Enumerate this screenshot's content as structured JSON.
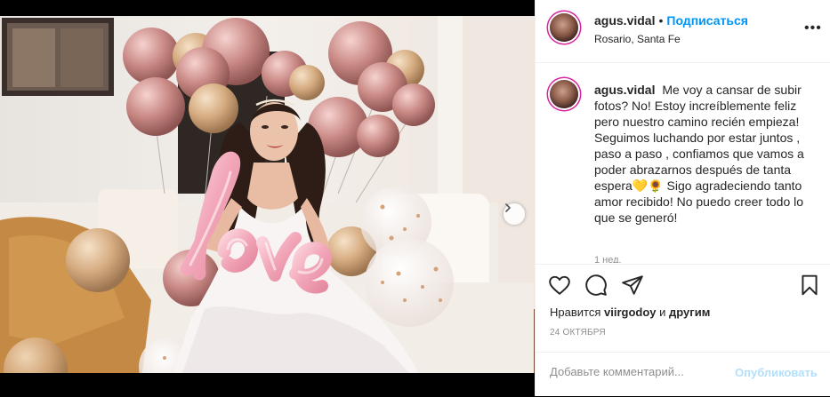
{
  "post": {
    "username": "agus.vidal",
    "follow_label": "Подписаться",
    "location": "Rosario, Santa Fe",
    "more_label": "•••",
    "caption_text": "Me voy a cansar de subir fotos? No! Estoy increíblemente feliz pero nuestro camino recién empieza! Seguimos luchando por estar juntos , paso a paso , confiamos que vamos a poder abrazarnos después de tanta espera💛🌻 Sigo agradeciendo tanto amor recibido! No puedo creer todo lo que se generó!",
    "time_ago": "1 нед.",
    "likes_prefix": "Нравится",
    "likes_user": "viirgodoy",
    "likes_and": "и",
    "likes_others": "другим",
    "date": "24 ОКТЯБРЯ",
    "balloon_text": "love"
  },
  "comment": {
    "placeholder": "Добавьте комментарий...",
    "publish_label": "Опубликовать"
  },
  "icons": {
    "like": "heart-icon",
    "comment": "comment-icon",
    "share": "paper-plane-icon",
    "save": "bookmark-icon",
    "next": "chevron-right-icon",
    "more": "ellipsis-icon"
  },
  "colors": {
    "link_blue": "#0095f6",
    "publish_disabled": "#b2dffc",
    "muted": "#8e8e8e"
  }
}
